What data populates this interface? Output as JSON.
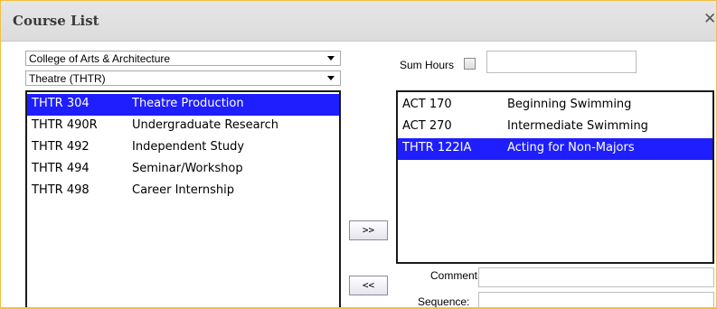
{
  "dialog": {
    "title": "Course List",
    "close_icon": "close-icon"
  },
  "filters": {
    "college": "College of Arts & Architecture",
    "department": "Theatre (THTR)"
  },
  "available_courses": [
    {
      "code": "THTR 304",
      "name": "Theatre Production",
      "selected": true
    },
    {
      "code": "THTR 490R",
      "name": "Undergraduate Research",
      "selected": false
    },
    {
      "code": "THTR 492",
      "name": "Independent Study",
      "selected": false
    },
    {
      "code": "THTR 494",
      "name": "Seminar/Workshop",
      "selected": false
    },
    {
      "code": "THTR 498",
      "name": "Career Internship",
      "selected": false
    }
  ],
  "chosen_courses": [
    {
      "code": "ACT 170",
      "name": "Beginning Swimming",
      "selected": false
    },
    {
      "code": "ACT 270",
      "name": "Intermediate Swimming",
      "selected": false
    },
    {
      "code": "THTR 122IA",
      "name": "Acting for Non-Majors",
      "selected": true
    }
  ],
  "controls": {
    "sum_hours_label": "Sum Hours",
    "sum_hours_checked": false,
    "sum_hours_value": "",
    "add_button": ">>",
    "remove_button": "<<",
    "comment_label": "Comment:",
    "comment_value": "",
    "sequence_label": "Sequence:",
    "sequence_value": ""
  },
  "colors": {
    "selection": "#1e1eff",
    "border_accent": "#f0c040"
  }
}
